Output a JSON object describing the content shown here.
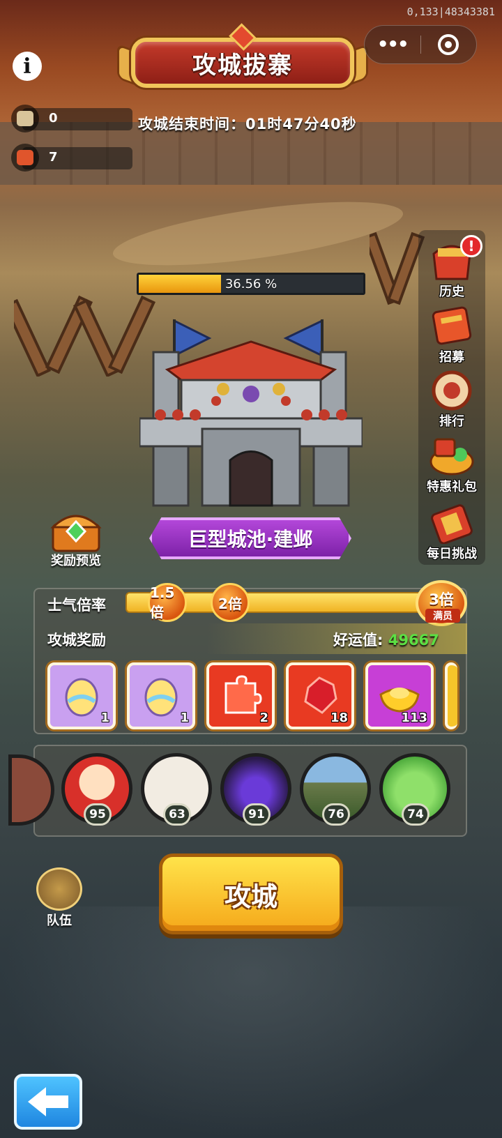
{
  "status": {
    "debug_text": "0,133|48343381"
  },
  "header": {
    "title": "攻城拔寨",
    "countdown_label": "攻城结束时间：",
    "countdown_value": "01时47分40秒",
    "capsule": {
      "more_label": "•••"
    }
  },
  "resources": [
    {
      "icon": "scroll-icon",
      "value": "0",
      "color": "#d8c49a"
    },
    {
      "icon": "banner-ticket-icon",
      "value": "7",
      "color": "#e0552c"
    }
  ],
  "siege": {
    "progress_percent": 36.56,
    "progress_text": "36.56 %",
    "city_name": "巨型城池·建邺"
  },
  "reward_preview": {
    "label": "奖励预览"
  },
  "side_menu": [
    {
      "label": "历史",
      "icon": "history-gift-icon",
      "badge": "!"
    },
    {
      "label": "招募",
      "icon": "recruit-scroll-icon"
    },
    {
      "label": "排行",
      "icon": "ranking-drum-icon"
    },
    {
      "label": "特惠礼包",
      "icon": "gift-pack-icon"
    },
    {
      "label": "每日挑战",
      "icon": "daily-challenge-icon"
    }
  ],
  "morale": {
    "label": "士气倍率",
    "multipliers": [
      "1.5倍",
      "2倍"
    ],
    "max_multiplier": "3倍",
    "max_note": "满员"
  },
  "rewards": {
    "label": "攻城奖励",
    "luck_label": "好运值:",
    "luck_value": "49667",
    "items": [
      {
        "icon": "rainbow-egg-icon",
        "count": "1",
        "bg": "#c9a0f0"
      },
      {
        "icon": "rainbow-egg-icon",
        "count": "1",
        "bg": "#c9a0f0"
      },
      {
        "icon": "puzzle-piece-icon",
        "count": "2",
        "bg": "#e83a22"
      },
      {
        "icon": "red-gem-icon",
        "count": "18",
        "bg": "#e83a22"
      },
      {
        "icon": "gold-ingot-icon",
        "count": "113",
        "bg": "#c73fd6"
      }
    ]
  },
  "team": {
    "members": [
      {
        "name": "santa-avatar",
        "level": "95"
      },
      {
        "name": "text-avatar",
        "level": "63"
      },
      {
        "name": "purple-monster-avatar",
        "level": "91"
      },
      {
        "name": "landscape-avatar",
        "level": "76"
      },
      {
        "name": "frog-avatar",
        "level": "74"
      }
    ],
    "team_label": "队伍"
  },
  "actions": {
    "attack_label": "攻城"
  }
}
